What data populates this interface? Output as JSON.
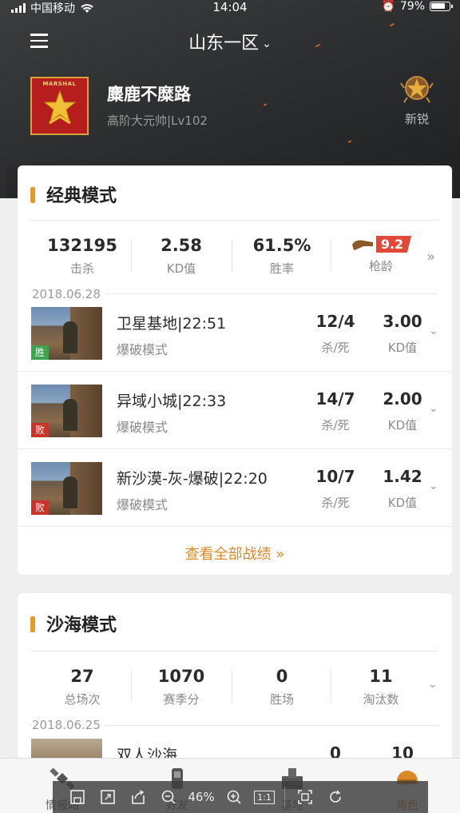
{
  "status_bar": {
    "carrier": "中国移动",
    "time": "14:04",
    "battery": "79%"
  },
  "header": {
    "server": "山东一区"
  },
  "profile": {
    "avatar_label": "MARSHAL",
    "name": "麋鹿不糜路",
    "rank": "高阶大元帅|Lv102",
    "badge_label": "新锐"
  },
  "classic": {
    "title": "经典模式",
    "stats": [
      {
        "value": "132195",
        "label": "击杀"
      },
      {
        "value": "2.58",
        "label": "KD值"
      },
      {
        "value": "61.5%",
        "label": "胜率"
      },
      {
        "value": "9.2",
        "label": "枪龄"
      }
    ],
    "date": "2018.06.28",
    "matches": [
      {
        "result": "胜",
        "map": "卫星基地|22:51",
        "mode": "爆破模式",
        "kd": "12/4",
        "kd_label": "杀/死",
        "kdv": "3.00",
        "kdv_label": "KD值"
      },
      {
        "result": "败",
        "map": "异域小城|22:33",
        "mode": "爆破模式",
        "kd": "14/7",
        "kd_label": "杀/死",
        "kdv": "2.00",
        "kdv_label": "KD值"
      },
      {
        "result": "败",
        "map": "新沙漠-灰-爆破|22:20",
        "mode": "爆破模式",
        "kd": "10/7",
        "kd_label": "杀/死",
        "kdv": "1.42",
        "kdv_label": "KD值"
      }
    ],
    "view_all": "查看全部战绩 »"
  },
  "desert": {
    "title": "沙海模式",
    "stats": [
      {
        "value": "27",
        "label": "总场次"
      },
      {
        "value": "1070",
        "label": "赛季分"
      },
      {
        "value": "0",
        "label": "胜场"
      },
      {
        "value": "11",
        "label": "淘汰数"
      }
    ],
    "date": "2018.06.25",
    "match": {
      "map": "双人沙海",
      "v1": "0",
      "v2": "10"
    }
  },
  "tabs": [
    {
      "label": "情报站",
      "icon": "satellite-icon"
    },
    {
      "label": "好友",
      "icon": "friends-icon"
    },
    {
      "label": "基地",
      "icon": "base-icon"
    },
    {
      "label": "角色",
      "icon": "helmet-icon"
    }
  ],
  "viewer": {
    "zoom": "46%",
    "ratio": "1:1"
  },
  "colors": {
    "accent": "#d88a2a",
    "win": "#3fa34d",
    "lose": "#c8332b",
    "header_bg": "#2e2f30"
  }
}
